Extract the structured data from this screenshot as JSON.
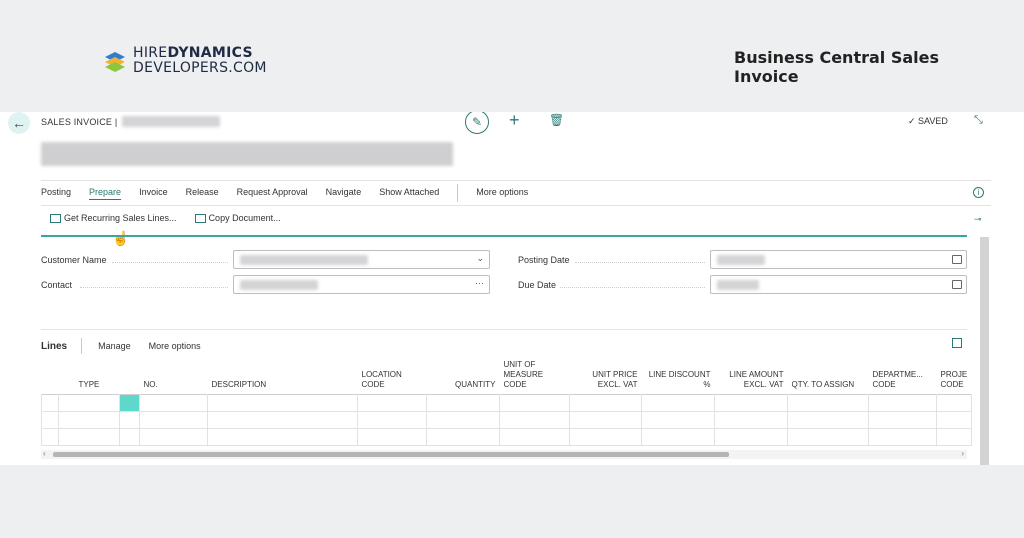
{
  "brand": {
    "line1_bold": "HIRE",
    "line1_rest": "DYNAMICS",
    "line2": "DEVELOPERS.COM"
  },
  "headline": "Business Central Sales Invoice",
  "page": {
    "breadcrumb": "SALES INVOICE |",
    "saved": "SAVED"
  },
  "actions": [
    "Posting",
    "Prepare",
    "Invoice",
    "Release",
    "Request Approval",
    "Navigate",
    "Show Attached"
  ],
  "actions_more": "More options",
  "subactions": [
    "Get Recurring Sales Lines...",
    "Copy Document..."
  ],
  "fields": {
    "customer_name": "Customer Name",
    "contact": "Contact",
    "posting_date": "Posting Date",
    "due_date": "Due Date"
  },
  "lines": {
    "title": "Lines",
    "manage": "Manage",
    "more": "More options",
    "columns": [
      {
        "key": "type",
        "label": "TYPE"
      },
      {
        "key": "no",
        "label": "NO."
      },
      {
        "key": "description",
        "label": "DESCRIPTION"
      },
      {
        "key": "location",
        "label": "LOCATION CODE"
      },
      {
        "key": "quantity",
        "label": "QUANTITY"
      },
      {
        "key": "uom",
        "label": "UNIT OF MEASURE CODE"
      },
      {
        "key": "unit_price",
        "label": "UNIT PRICE EXCL. VAT"
      },
      {
        "key": "line_discount",
        "label": "LINE DISCOUNT %"
      },
      {
        "key": "line_amount",
        "label": "LINE AMOUNT EXCL. VAT"
      },
      {
        "key": "qty_assign",
        "label": "QTY. TO ASSIGN"
      },
      {
        "key": "department",
        "label": "DEPARTME... CODE"
      },
      {
        "key": "project",
        "label": "PROJE CODE"
      }
    ]
  },
  "colors": {
    "accent": "#2c7a73",
    "teal_line": "#3aa79b",
    "selected_cell": "#5fd7ca"
  }
}
